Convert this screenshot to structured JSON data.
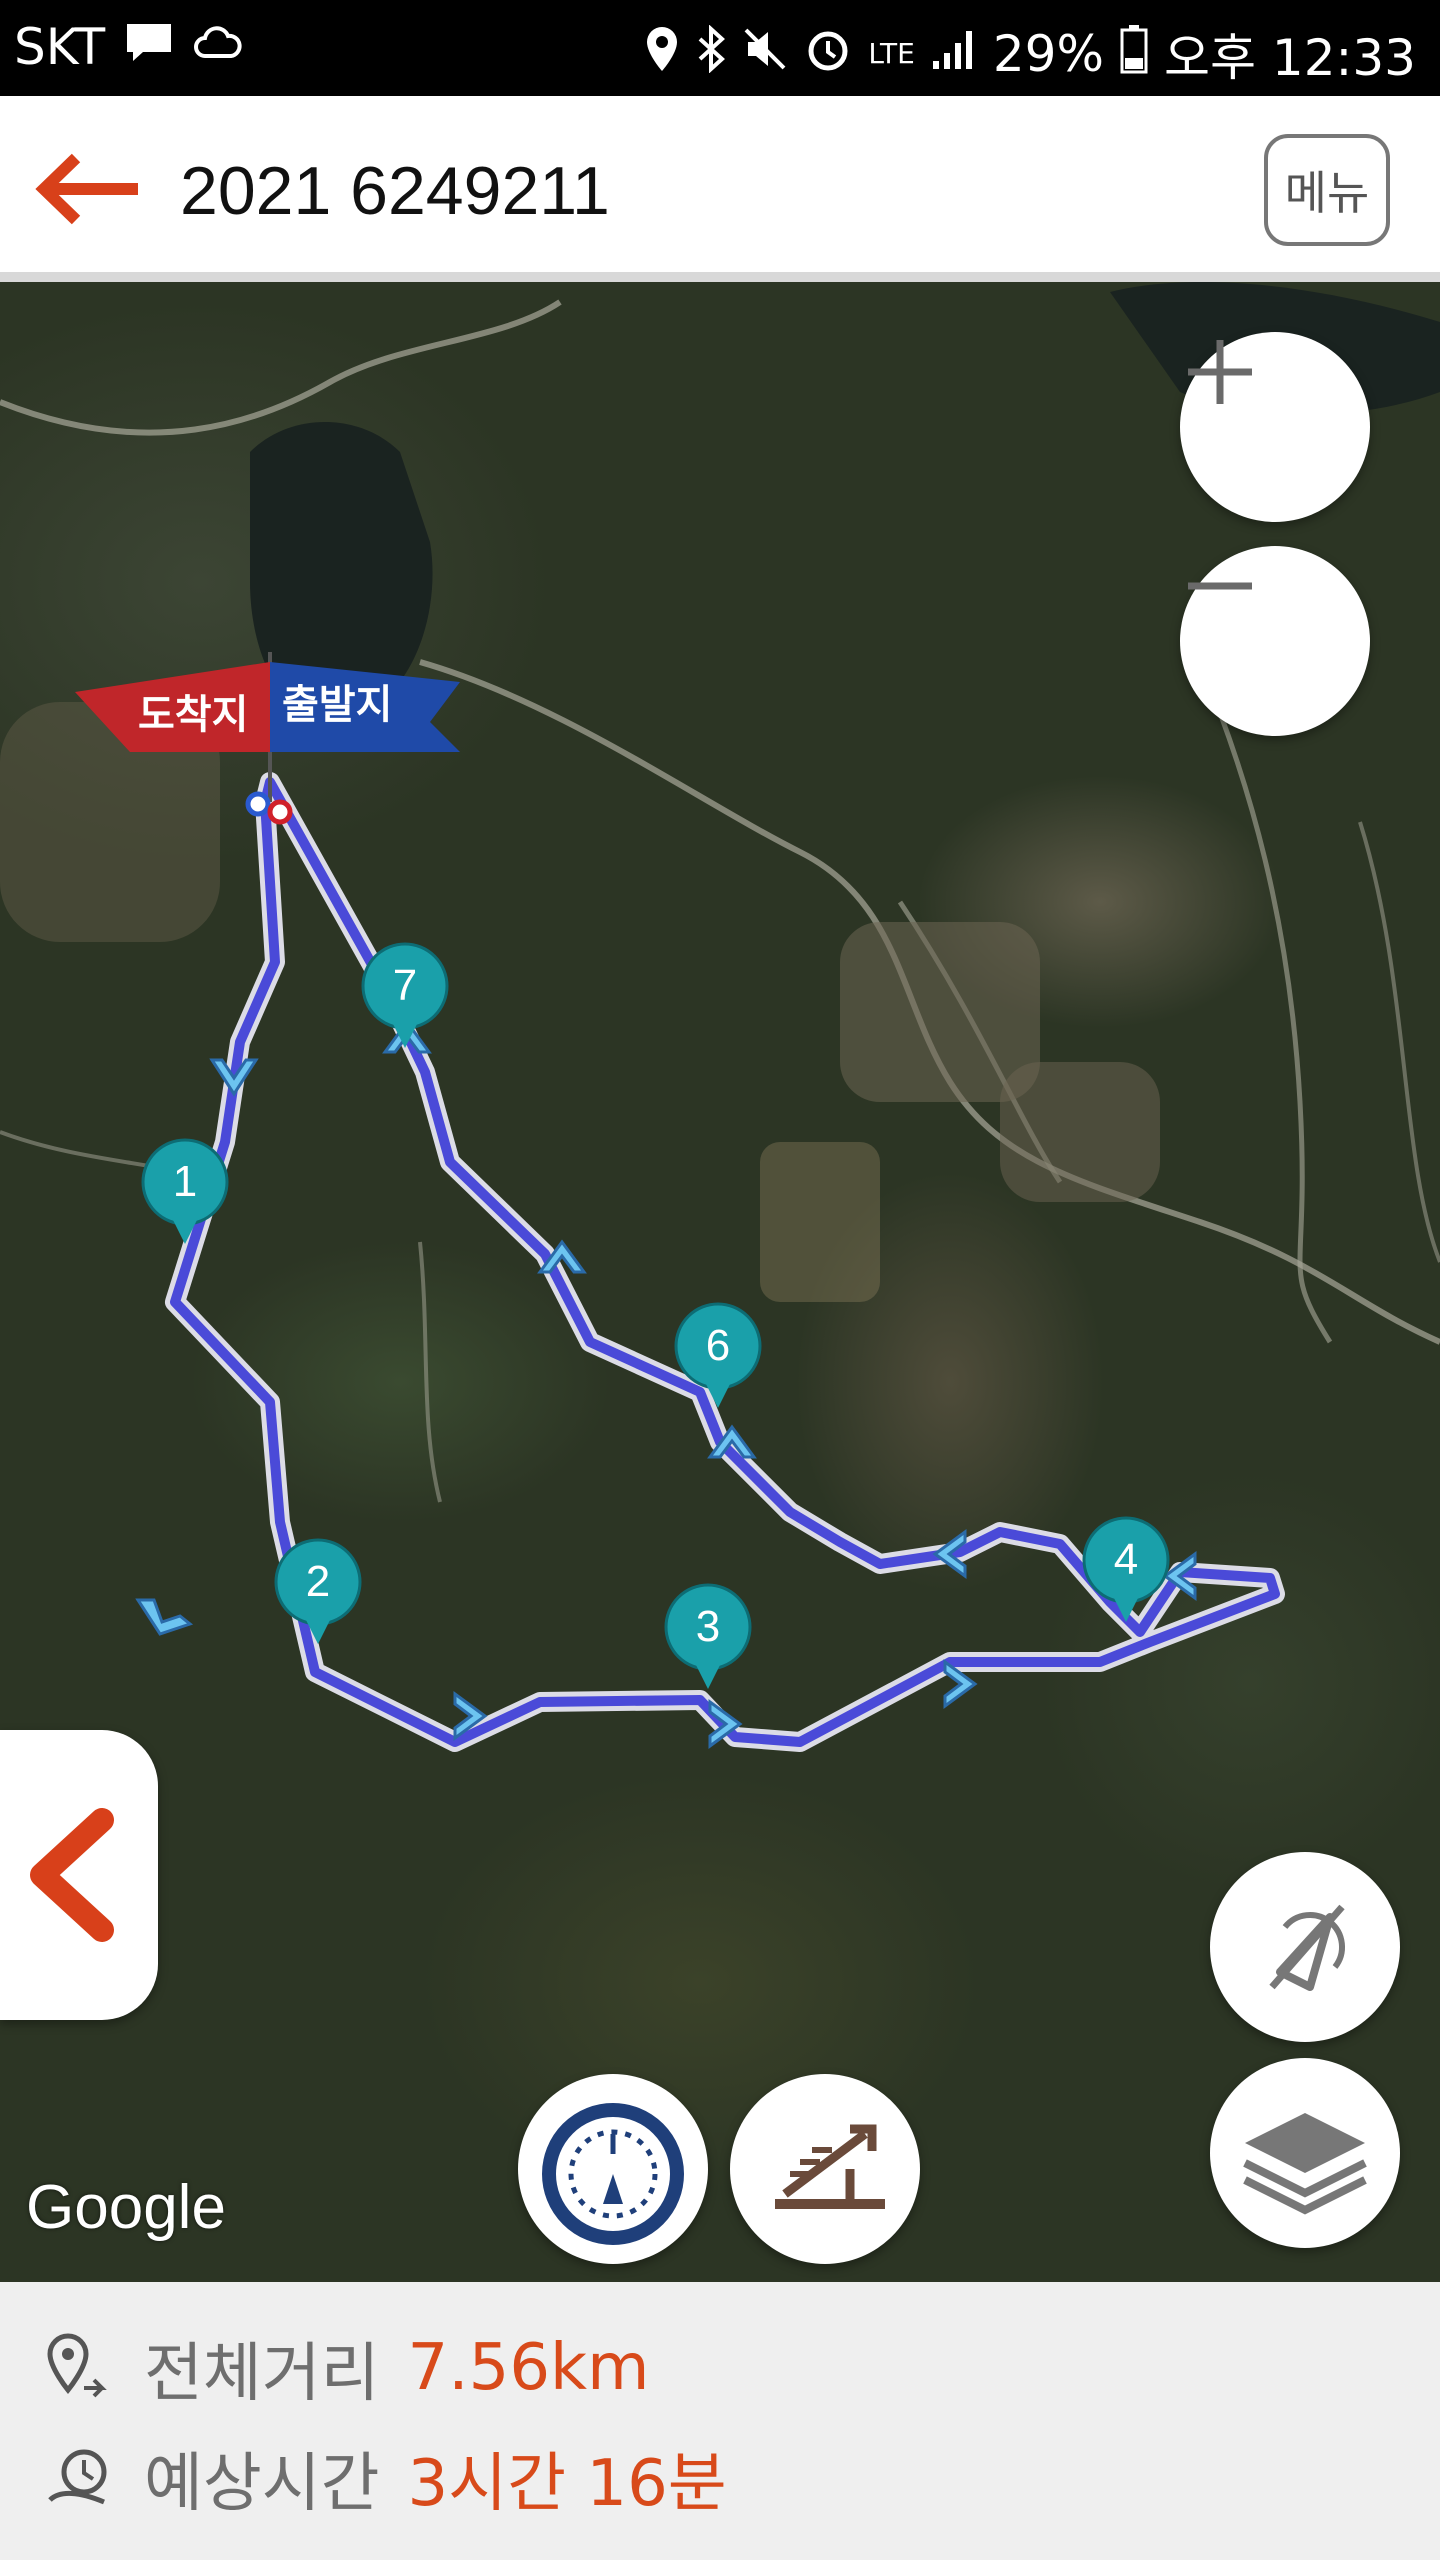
{
  "status_bar": {
    "carrier": "SKT",
    "network": "LTE",
    "battery": "29%",
    "time": "오후 12:33",
    "icons": [
      "message-icon",
      "cloud-icon",
      "location-icon",
      "bluetooth-icon",
      "mute-icon",
      "alarm-icon",
      "signal-icon",
      "battery-icon"
    ]
  },
  "header": {
    "title": "2021 6249211",
    "menu_label": "메뉴"
  },
  "map": {
    "provider_logo": "Google",
    "start_flag": "출발지",
    "end_flag": "도착지",
    "markers": [
      "1",
      "2",
      "3",
      "4",
      "6",
      "7"
    ],
    "route_color": "#4a4ad8",
    "marker_color": "#1aa0aa",
    "controls": [
      "zoom-in-icon",
      "zoom-out-icon",
      "compass-off-icon",
      "layers-icon",
      "speedometer-icon",
      "elevation-icon",
      "chevron-left-icon"
    ]
  },
  "summary": {
    "distance_label": "전체거리",
    "distance_value": "7.56km",
    "time_label": "예상시간",
    "time_value": "3시간 16분"
  }
}
